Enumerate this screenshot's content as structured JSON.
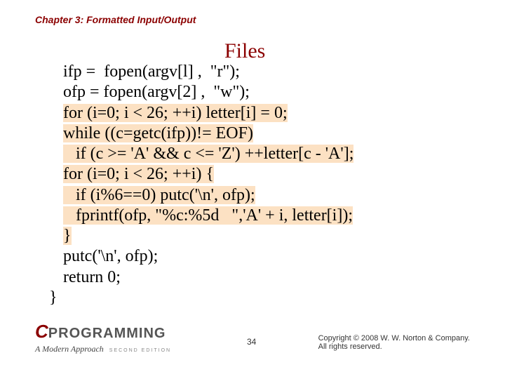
{
  "header": {
    "chapter": "Chapter 3: Formatted Input/Output"
  },
  "slide": {
    "title": "Files"
  },
  "code": {
    "l1": "ifp =  fopen(argv[l] ,  \"r\");",
    "l2": "ofp = fopen(argv[2] ,  \"w\");",
    "l3": "for (i=0; i < 26; ++i) letter[i] = 0;",
    "l4": "while ((c=getc(ifp))!= EOF)",
    "l5": "   if (c >= 'A' && c <= 'Z') ++letter[c - 'A'];",
    "l6": "for (i=0; i < 26; ++i) {",
    "l7": "   if (i%6==0) putc('\\n', ofp);",
    "l8": "   fprintf(ofp, \"%c:%5d   \",'A' + i, letter[i]);",
    "l9": "}",
    "l10": "putc('\\n', ofp);",
    "l11": "return 0;",
    "l12": "}"
  },
  "footer": {
    "logo_c": "C",
    "logo_prog": "PROGRAMMING",
    "logo_sub": "A Modern Approach",
    "logo_ed": "SECOND EDITION",
    "page": "34",
    "copyright1": "Copyright © 2008 W. W. Norton & Company.",
    "copyright2": "All rights reserved."
  }
}
